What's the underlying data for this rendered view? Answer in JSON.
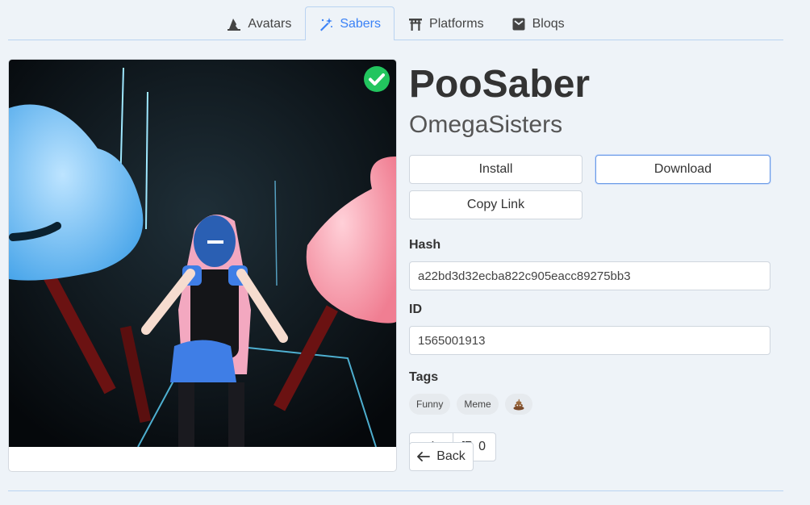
{
  "tabs": [
    {
      "label": "Avatars",
      "icon": "wizard-hat-icon"
    },
    {
      "label": "Sabers",
      "icon": "magic-wand-icon",
      "active": true
    },
    {
      "label": "Platforms",
      "icon": "torii-gate-icon"
    },
    {
      "label": "Bloqs",
      "icon": "cube-box-icon"
    }
  ],
  "model": {
    "name": "PooSaber",
    "author": "OmegaSisters",
    "verified": true
  },
  "actions": {
    "install": "Install",
    "download": "Download",
    "copy_link": "Copy Link"
  },
  "hash": {
    "label": "Hash",
    "value": "a22bd3d32ecba822c905eacc89275bb3"
  },
  "id": {
    "label": "ID",
    "value": "1565001913"
  },
  "tags": {
    "label": "Tags",
    "items": [
      "Funny",
      "Meme"
    ],
    "emoji_tag_icon": "poop-emoji-icon"
  },
  "votes": {
    "down_count": "0"
  },
  "back_label": "Back",
  "colors": {
    "accent": "#3b82f6",
    "verified": "#22c55e",
    "background": "#eef3f8"
  }
}
